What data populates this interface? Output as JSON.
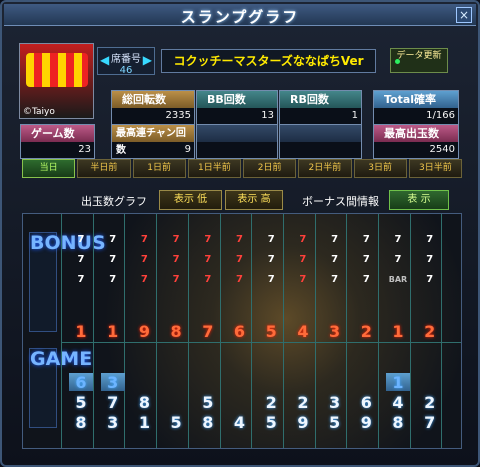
{
  "window": {
    "title": "スランプグラフ",
    "close_label": "×"
  },
  "machine": {
    "thumb_brand": "©Taiyo",
    "seat_label": "席番号",
    "seat_number": "46",
    "name": "コクッチーマスターズななぱちVer",
    "update_label": "データ更新"
  },
  "stats": {
    "total_spins_label": "総回転数",
    "total_spins": "2335",
    "bb_label": "BB回数",
    "bb": "13",
    "rb_label": "RB回数",
    "rb": "1",
    "total_rate_label": "Total確率",
    "total_rate": "1/166",
    "games_label": "ゲーム数",
    "games": "23",
    "max_chain_label": "最高連チャン回数",
    "max_chain": "9",
    "max_payout_label": "最高出玉数",
    "max_payout": "2540"
  },
  "days": [
    "当日",
    "半日前",
    "1日前",
    "1日半前",
    "2日前",
    "2日半前",
    "3日前",
    "3日半前"
  ],
  "graph_controls": {
    "graph_label": "出玉数グラフ",
    "btn_low": "表示 低",
    "btn_high": "表示 高",
    "bonus_info_label": "ボーナス間情報",
    "btn_show": "表 示"
  },
  "bonus_band": "BONUS",
  "game_band": "GAME",
  "bonus_rows": [
    [
      "7",
      "7",
      "7",
      "7",
      "7",
      "7",
      "7",
      "7",
      "7",
      "7",
      "7",
      "7"
    ],
    [
      "7",
      "7",
      "7",
      "7",
      "7",
      "7",
      "7",
      "7",
      "7",
      "7",
      "7",
      "7"
    ],
    [
      "7",
      "7",
      "7",
      "7",
      "7",
      "7",
      "7",
      "7",
      "7",
      "7",
      "BAR",
      "7"
    ]
  ],
  "bonus_colors": [
    [
      "w",
      "w",
      "r",
      "r",
      "r",
      "r",
      "w",
      "r",
      "w",
      "w",
      "w",
      "w"
    ],
    [
      "w",
      "w",
      "r",
      "r",
      "r",
      "r",
      "w",
      "r",
      "w",
      "w",
      "w",
      "w"
    ],
    [
      "w",
      "w",
      "r",
      "r",
      "r",
      "r",
      "w",
      "r",
      "w",
      "w",
      "bar",
      "w"
    ]
  ],
  "rank_row": [
    "1",
    "1",
    "9",
    "8",
    "7",
    "6",
    "5",
    "4",
    "3",
    "2",
    "1",
    "2"
  ],
  "game_rows": [
    [
      "6",
      "3",
      "",
      "",
      "",
      "",
      "",
      "",
      "",
      "",
      "1",
      ""
    ],
    [
      "5",
      "7",
      "8",
      "",
      "5",
      "",
      "2",
      "2",
      "3",
      "6",
      "4",
      "2"
    ],
    [
      "8",
      "3",
      "1",
      "5",
      "8",
      "4",
      "5",
      "9",
      "5",
      "9",
      "8",
      "7"
    ]
  ]
}
